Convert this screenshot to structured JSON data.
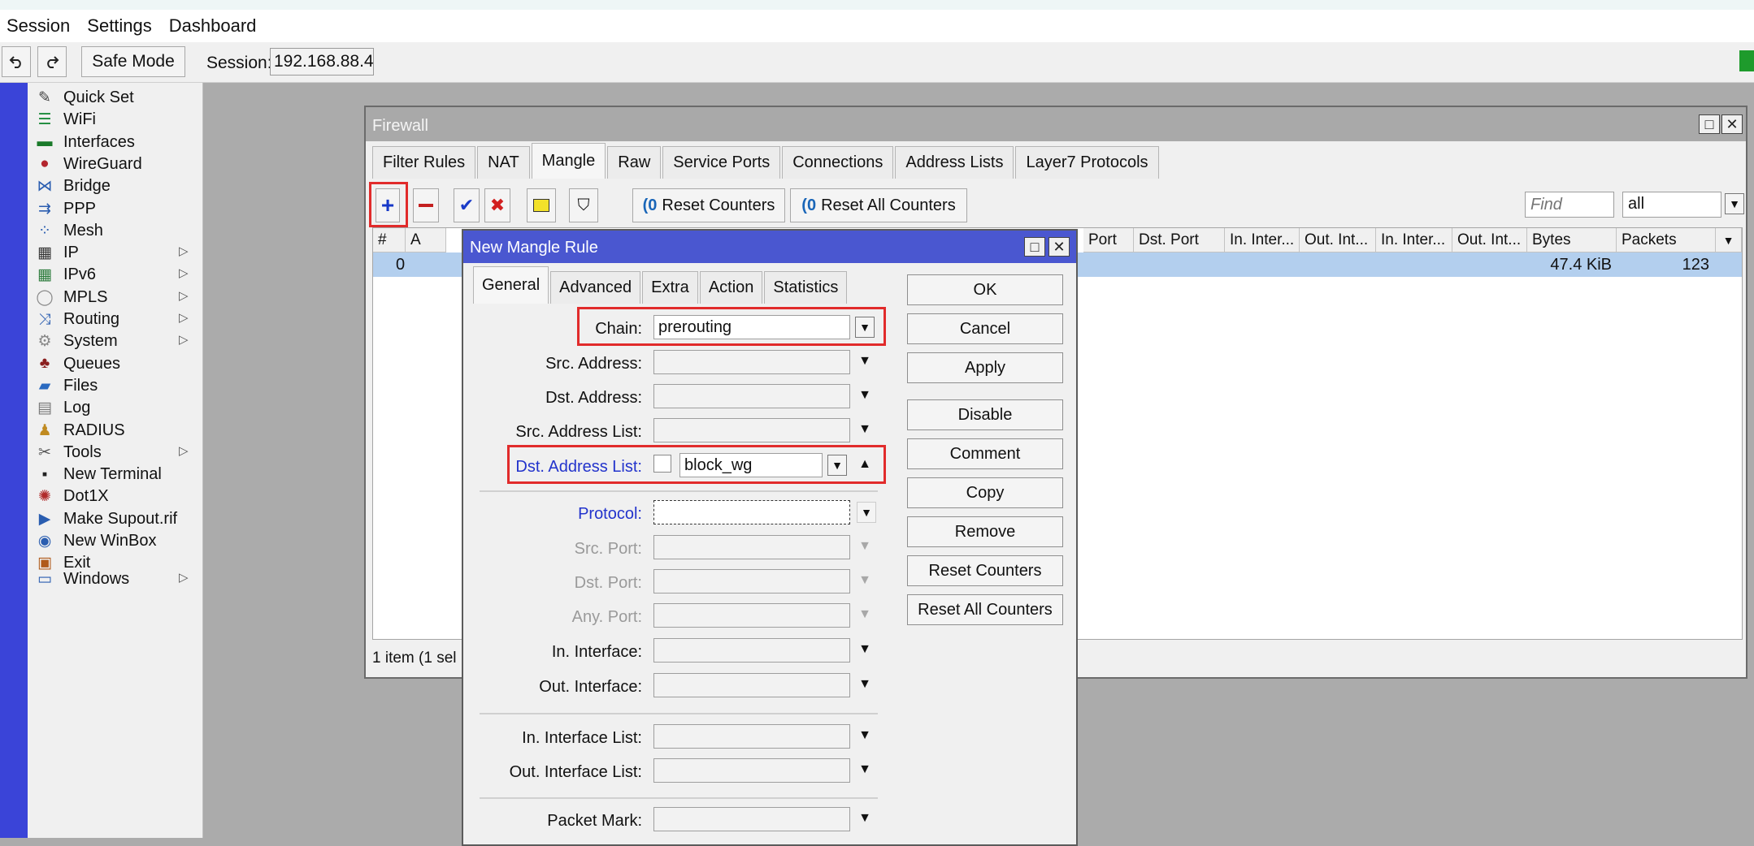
{
  "menu": [
    "Session",
    "Settings",
    "Dashboard"
  ],
  "toolbar": {
    "undo_icon": "undo-arrow",
    "redo_icon": "redo-arrow",
    "safe_mode": "Safe Mode",
    "session_label": "Session:",
    "session_value": "192.168.88.4"
  },
  "sidebar": {
    "items": [
      {
        "label": "Quick Set",
        "icon": "wand-icon"
      },
      {
        "label": "WiFi",
        "icon": "wifi-icon"
      },
      {
        "label": "Interfaces",
        "icon": "interfaces-icon"
      },
      {
        "label": "WireGuard",
        "icon": "wireguard-icon"
      },
      {
        "label": "Bridge",
        "icon": "bridge-icon"
      },
      {
        "label": "PPP",
        "icon": "ppp-icon"
      },
      {
        "label": "Mesh",
        "icon": "mesh-icon"
      },
      {
        "label": "IP",
        "icon": "ip-icon",
        "submenu": true
      },
      {
        "label": "IPv6",
        "icon": "ipv6-icon",
        "submenu": true
      },
      {
        "label": "MPLS",
        "icon": "mpls-icon",
        "submenu": true
      },
      {
        "label": "Routing",
        "icon": "routing-icon",
        "submenu": true
      },
      {
        "label": "System",
        "icon": "gear-icon",
        "submenu": true
      },
      {
        "label": "Queues",
        "icon": "queues-icon"
      },
      {
        "label": "Files",
        "icon": "folder-icon"
      },
      {
        "label": "Log",
        "icon": "log-icon"
      },
      {
        "label": "RADIUS",
        "icon": "radius-icon"
      },
      {
        "label": "Tools",
        "icon": "tools-icon",
        "submenu": true
      },
      {
        "label": "New Terminal",
        "icon": "terminal-icon"
      },
      {
        "label": "Dot1X",
        "icon": "dot1x-icon"
      },
      {
        "label": "Make Supout.rif",
        "icon": "supout-icon"
      },
      {
        "label": "New WinBox",
        "icon": "winbox-icon"
      },
      {
        "label": "Exit",
        "icon": "exit-icon"
      },
      {
        "label": "Windows",
        "icon": "windows-icon",
        "submenu": true
      }
    ],
    "submenu_arrow": "▷"
  },
  "firewall": {
    "title": "Firewall",
    "tabs": [
      "Filter Rules",
      "NAT",
      "Mangle",
      "Raw",
      "Service Ports",
      "Connections",
      "Address Lists",
      "Layer7 Protocols"
    ],
    "active_tab": "Mangle",
    "reset_counters": "Reset Counters",
    "reset_all_counters": "Reset All Counters",
    "find_placeholder": "Find",
    "filter_value": "all",
    "columns": [
      "#",
      "A",
      "Port",
      "Dst. Port",
      "In. Inter...",
      "Out. Int...",
      "In. Inter...",
      "Out. Int...",
      "Bytes",
      "Packets"
    ],
    "row": {
      "num": "0",
      "bytes": "47.4 KiB",
      "packets": "123"
    },
    "status": "1 item (1 sel"
  },
  "dialog": {
    "title": "New Mangle Rule",
    "tabs": [
      "General",
      "Advanced",
      "Extra",
      "Action",
      "Statistics"
    ],
    "active_tab": "General",
    "fields": {
      "chain_label": "Chain:",
      "chain_value": "prerouting",
      "src_address_label": "Src. Address:",
      "dst_address_label": "Dst. Address:",
      "src_address_list_label": "Src. Address List:",
      "dst_address_list_label": "Dst. Address List:",
      "dst_address_list_value": "block_wg",
      "protocol_label": "Protocol:",
      "src_port_label": "Src. Port:",
      "dst_port_label": "Dst. Port:",
      "any_port_label": "Any. Port:",
      "in_interface_label": "In. Interface:",
      "out_interface_label": "Out. Interface:",
      "in_interface_list_label": "In. Interface List:",
      "out_interface_list_label": "Out. Interface List:",
      "packet_mark_label": "Packet Mark:"
    },
    "buttons": [
      "OK",
      "Cancel",
      "Apply",
      "Disable",
      "Comment",
      "Copy",
      "Remove",
      "Reset Counters",
      "Reset All Counters"
    ]
  },
  "colors": {
    "dialog_title": "#4a57d0",
    "sidebar_strip": "#3a44d8",
    "highlight_box": "#e12b2b",
    "selected_row": "#b3cfee",
    "blue_label": "#2233cc"
  }
}
